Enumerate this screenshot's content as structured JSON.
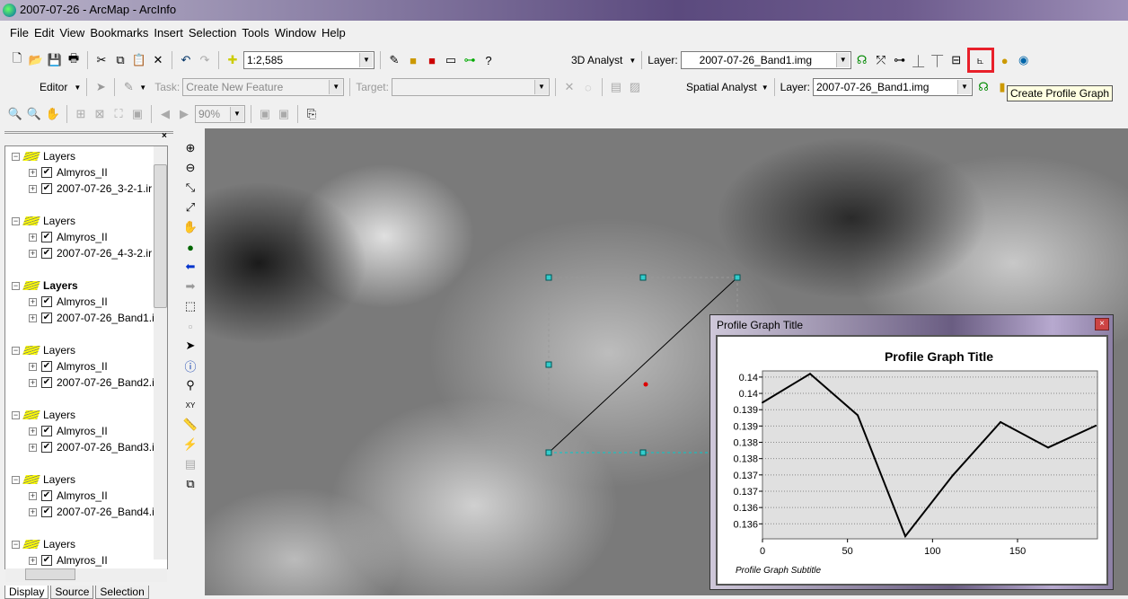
{
  "window": {
    "title": "2007-07-26 - ArcMap - ArcInfo"
  },
  "menu": [
    "File",
    "Edit",
    "View",
    "Bookmarks",
    "Insert",
    "Selection",
    "Tools",
    "Window",
    "Help"
  ],
  "toolbar": {
    "scale": "1:2,585",
    "analyst3d": "3D Analyst",
    "layer_label": "Layer:",
    "layer_value": "2007-07-26_Band1.img",
    "editor": "Editor",
    "task_label": "Task:",
    "task_value": "Create New Feature",
    "target_label": "Target:",
    "spatial_analyst": "Spatial Analyst",
    "sa_layer_label": "Layer:",
    "sa_layer_value": "2007-07-26_Band1.img",
    "zoom_pct": "90%",
    "tooltip": "Create Profile Graph",
    "highlight_color": "#e8202a"
  },
  "toc": {
    "groups": [
      {
        "name": "Layers",
        "bold": false,
        "items": [
          "Almyros_II",
          "2007-07-26_3-2-1.ir"
        ]
      },
      {
        "name": "Layers",
        "bold": false,
        "items": [
          "Almyros_II",
          "2007-07-26_4-3-2.ir"
        ]
      },
      {
        "name": "Layers",
        "bold": true,
        "items": [
          "Almyros_II",
          "2007-07-26_Band1.i"
        ]
      },
      {
        "name": "Layers",
        "bold": false,
        "items": [
          "Almyros_II",
          "2007-07-26_Band2.i"
        ]
      },
      {
        "name": "Layers",
        "bold": false,
        "items": [
          "Almyros_II",
          "2007-07-26_Band3.i"
        ]
      },
      {
        "name": "Layers",
        "bold": false,
        "items": [
          "Almyros_II",
          "2007-07-26_Band4.i"
        ]
      },
      {
        "name": "Layers",
        "bold": false,
        "items": [
          "Almyros_II"
        ]
      }
    ],
    "tabs": [
      "Display",
      "Source",
      "Selection"
    ]
  },
  "graph_window": {
    "title": "Profile Graph Title"
  },
  "chart_data": {
    "type": "line",
    "title": "Profile Graph Title",
    "subtitle": "Profile Graph Subtitle",
    "x": [
      0,
      28,
      56,
      84,
      112,
      140,
      168,
      196
    ],
    "y": [
      0.13922,
      0.1401,
      0.13883,
      0.13512,
      0.13699,
      0.13862,
      0.13784,
      0.13851
    ],
    "xlim": [
      0,
      197
    ],
    "ylim": [
      0.13504,
      0.14019
    ],
    "xticks": [
      0,
      50,
      100,
      150
    ],
    "yticks": [
      0.14,
      0.1395,
      0.139,
      0.1385,
      0.138,
      0.1375,
      0.137,
      0.1365,
      0.136,
      0.1355
    ],
    "ytick_labels": [
      "0.14",
      "0.14",
      "0.139",
      "0.139",
      "0.138",
      "0.138",
      "0.137",
      "0.137",
      "0.136",
      "0.136"
    ],
    "grid": true,
    "plot_bg": "#e0e0e0",
    "line_color": "#000000"
  }
}
